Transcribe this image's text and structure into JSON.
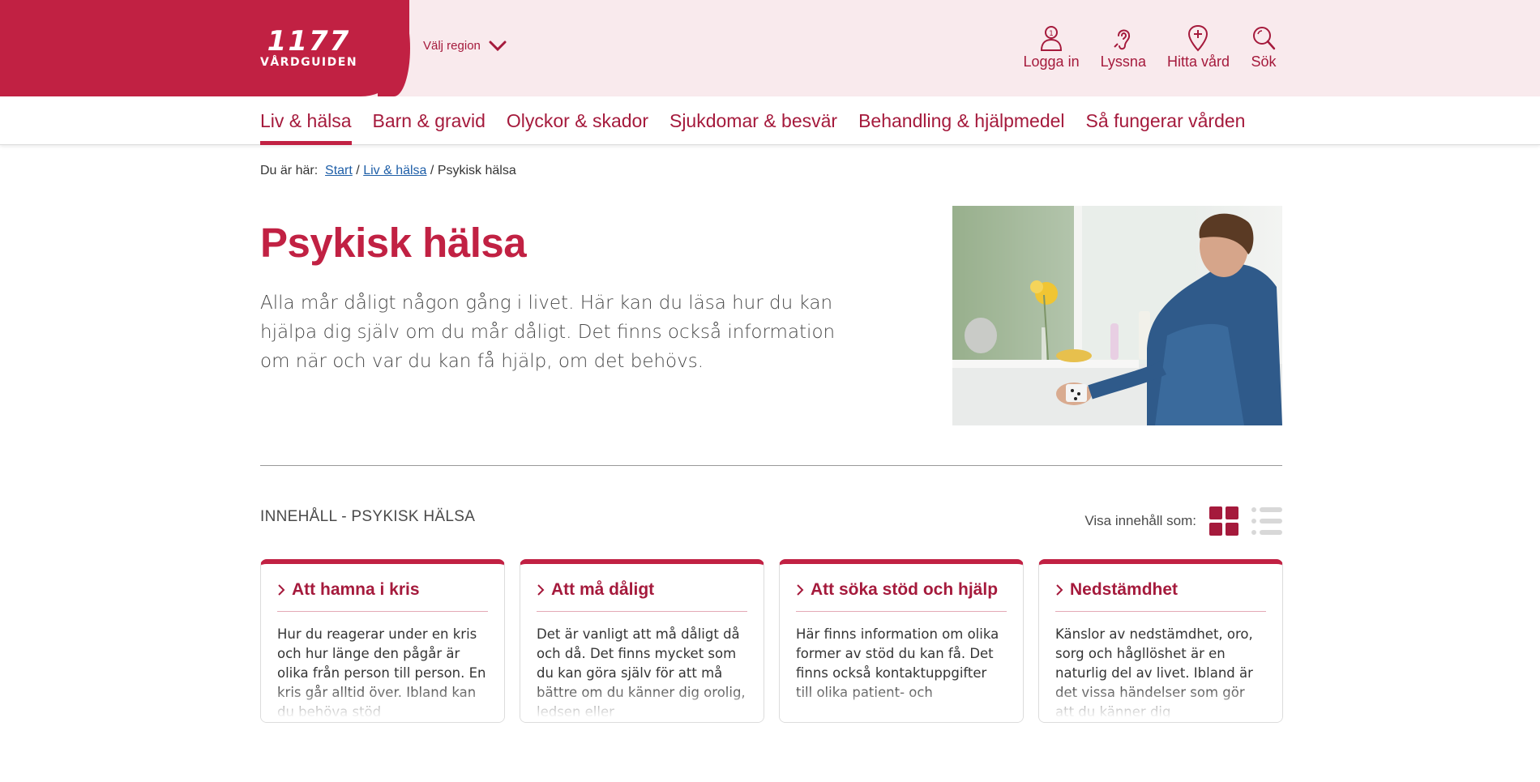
{
  "header": {
    "logo_number": "1177",
    "logo_text": "VÅRDGUIDEN",
    "region_label": "Välj region",
    "actions": [
      {
        "label": "Logga in",
        "icon": "user-icon"
      },
      {
        "label": "Lyssna",
        "icon": "ear-icon"
      },
      {
        "label": "Hitta vård",
        "icon": "map-pin-plus-icon"
      },
      {
        "label": "Sök",
        "icon": "search-icon"
      }
    ]
  },
  "nav": {
    "items": [
      {
        "label": "Liv & hälsa",
        "active": true
      },
      {
        "label": "Barn & gravid"
      },
      {
        "label": "Olyckor & skador"
      },
      {
        "label": "Sjukdomar & besvär"
      },
      {
        "label": "Behandling & hjälpmedel"
      },
      {
        "label": "Så fungerar vården"
      }
    ]
  },
  "breadcrumb": {
    "prefix": "Du är här:",
    "links": [
      "Start",
      "Liv & hälsa"
    ],
    "current": "Psykisk hälsa",
    "separator": "/"
  },
  "hero": {
    "title": "Psykisk hälsa",
    "lead": "Alla mår dåligt någon gång i livet. Här kan du läsa hur du kan hjälpa dig själv om du mår dåligt. Det finns också information om när och var du kan få hjälp, om det behövs."
  },
  "content": {
    "heading": "INNEHÅLL - PSYKISK HÄLSA",
    "view_label": "Visa innehåll som:",
    "cards": [
      {
        "title": "Att hamna i kris",
        "text": "Hur du reagerar under en kris och hur länge den pågår är olika från person till person. En kris går alltid över. Ibland kan du behöva stöd"
      },
      {
        "title": "Att må dåligt",
        "text": "Det är vanligt att må dåligt då och då. Det finns mycket som du kan göra själv för att må bättre om du känner dig orolig, ledsen eller"
      },
      {
        "title": "Att söka stöd och hjälp",
        "text": "Här finns information om olika former av stöd du kan få. Det finns också kontaktuppgifter till olika patient- och"
      },
      {
        "title": "Nedstämdhet",
        "text": "Känslor av nedstämdhet, oro, sorg och hågllöshet är en naturlig del av livet. Ibland är det vissa händelser som gör att du känner dig"
      }
    ]
  },
  "colors": {
    "brand": "#c12143",
    "brand_dark": "#a51a3c",
    "header_bg": "#f9eaed",
    "link": "#1f5fa8"
  }
}
